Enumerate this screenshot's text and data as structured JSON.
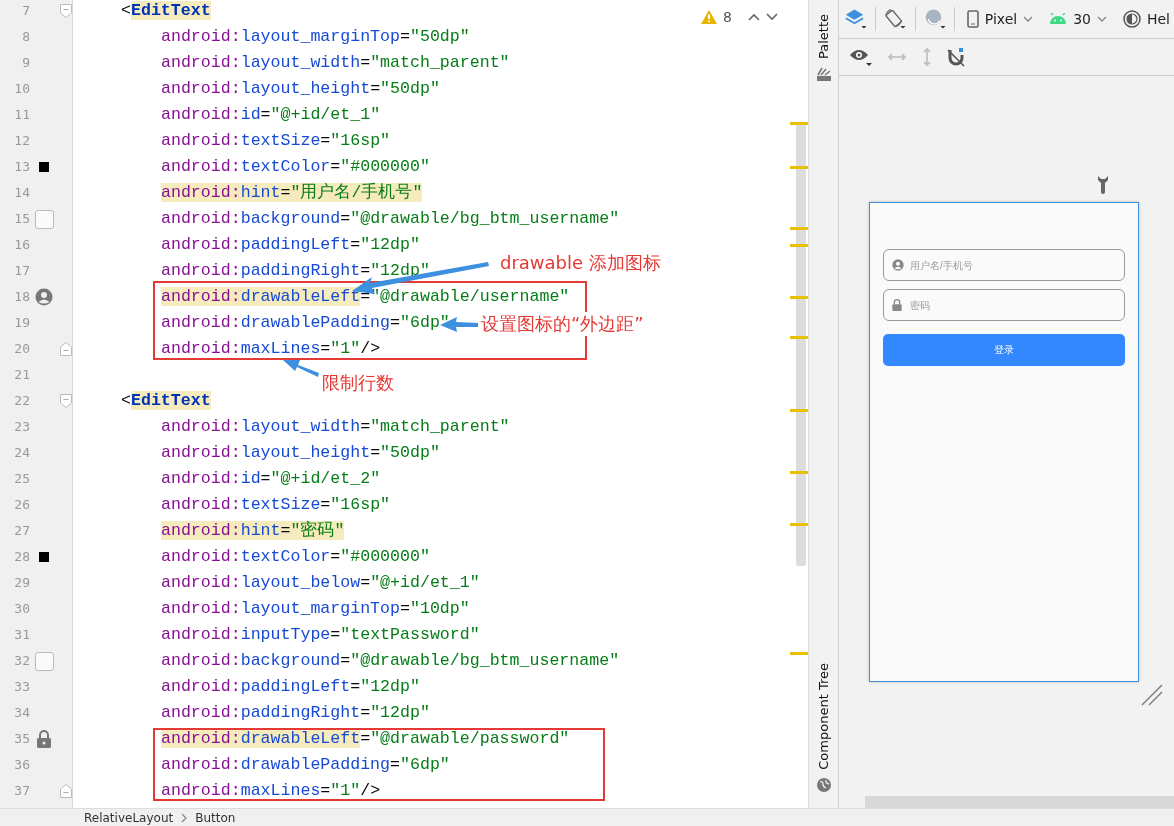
{
  "editor": {
    "warning_count": "8",
    "lines": [
      {
        "number": "7",
        "kind": "tag",
        "fold_marker": {
          "kind": "start"
        },
        "tokens": [
          {
            "text": "<",
            "kind": "punct",
            "highlighted": false
          },
          {
            "text": "EditText",
            "kind": "tag",
            "highlighted": true
          }
        ]
      },
      {
        "number": "8",
        "kind": "attribute",
        "tokens": [
          {
            "text": "android:",
            "kind": "ns",
            "highlighted": false
          },
          {
            "text": "layout_marginTop",
            "kind": "attr",
            "highlighted": false
          },
          {
            "text": "=",
            "kind": "punct",
            "highlighted": false
          },
          {
            "text": "\"50dp\"",
            "kind": "string",
            "highlighted": false
          }
        ]
      },
      {
        "number": "9",
        "kind": "attribute",
        "tokens": [
          {
            "text": "android:",
            "kind": "ns",
            "highlighted": false
          },
          {
            "text": "layout_width",
            "kind": "attr",
            "highlighted": false
          },
          {
            "text": "=",
            "kind": "punct",
            "highlighted": false
          },
          {
            "text": "\"match_parent\"",
            "kind": "string",
            "highlighted": false
          }
        ]
      },
      {
        "number": "10",
        "kind": "attribute",
        "tokens": [
          {
            "text": "android:",
            "kind": "ns",
            "highlighted": false
          },
          {
            "text": "layout_height",
            "kind": "attr",
            "highlighted": false
          },
          {
            "text": "=",
            "kind": "punct",
            "highlighted": false
          },
          {
            "text": "\"50dp\"",
            "kind": "string",
            "highlighted": false
          }
        ]
      },
      {
        "number": "11",
        "kind": "attribute",
        "tokens": [
          {
            "text": "android:",
            "kind": "ns",
            "highlighted": false
          },
          {
            "text": "id",
            "kind": "attr",
            "highlighted": false
          },
          {
            "text": "=",
            "kind": "punct",
            "highlighted": false
          },
          {
            "text": "\"@+id/et_1\"",
            "kind": "string",
            "highlighted": false
          }
        ]
      },
      {
        "number": "12",
        "kind": "attribute",
        "tokens": [
          {
            "text": "android:",
            "kind": "ns",
            "highlighted": false
          },
          {
            "text": "textSize",
            "kind": "attr",
            "highlighted": false
          },
          {
            "text": "=",
            "kind": "punct",
            "highlighted": false
          },
          {
            "text": "\"16sp\"",
            "kind": "string",
            "highlighted": false
          }
        ]
      },
      {
        "number": "13",
        "kind": "attribute",
        "gutter_icon": {
          "kind": "swatch"
        },
        "tokens": [
          {
            "text": "android:",
            "kind": "ns",
            "highlighted": false
          },
          {
            "text": "textColor",
            "kind": "attr",
            "highlighted": false
          },
          {
            "text": "=",
            "kind": "punct",
            "highlighted": false
          },
          {
            "text": "\"#000000\"",
            "kind": "string",
            "highlighted": false
          }
        ]
      },
      {
        "number": "14",
        "kind": "attribute",
        "tokens": [
          {
            "text": "android:",
            "kind": "ns",
            "highlighted": true
          },
          {
            "text": "hint",
            "kind": "attr",
            "highlighted": true
          },
          {
            "text": "=",
            "kind": "punct",
            "highlighted": true
          },
          {
            "text": "\"用户名/手机号\"",
            "kind": "string",
            "highlighted": true
          }
        ]
      },
      {
        "number": "15",
        "kind": "attribute",
        "gutter_icon": {
          "kind": "drawable"
        },
        "tokens": [
          {
            "text": "android:",
            "kind": "ns",
            "highlighted": false
          },
          {
            "text": "background",
            "kind": "attr",
            "highlighted": false
          },
          {
            "text": "=",
            "kind": "punct",
            "highlighted": false
          },
          {
            "text": "\"@drawable/bg_btm_username\"",
            "kind": "string",
            "highlighted": false
          }
        ]
      },
      {
        "number": "16",
        "kind": "attribute",
        "tokens": [
          {
            "text": "android:",
            "kind": "ns",
            "highlighted": false
          },
          {
            "text": "paddingLeft",
            "kind": "attr",
            "highlighted": false
          },
          {
            "text": "=",
            "kind": "punct",
            "highlighted": false
          },
          {
            "text": "\"12dp\"",
            "kind": "string",
            "highlighted": false
          }
        ]
      },
      {
        "number": "17",
        "kind": "attribute",
        "tokens": [
          {
            "text": "android:",
            "kind": "ns",
            "highlighted": false
          },
          {
            "text": "paddingRight",
            "kind": "attr",
            "highlighted": false
          },
          {
            "text": "=",
            "kind": "punct",
            "highlighted": false
          },
          {
            "text": "\"12dp\"",
            "kind": "string",
            "highlighted": false
          }
        ]
      },
      {
        "number": "18",
        "kind": "attribute",
        "gutter_icon": {
          "kind": "person"
        },
        "tokens": [
          {
            "text": "android:",
            "kind": "ns",
            "highlighted": true
          },
          {
            "text": "drawableLeft",
            "kind": "attr",
            "highlighted": true
          },
          {
            "text": "=",
            "kind": "punct",
            "highlighted": false
          },
          {
            "text": "\"@drawable/username\"",
            "kind": "string",
            "highlighted": false
          }
        ]
      },
      {
        "number": "19",
        "kind": "attribute",
        "tokens": [
          {
            "text": "android:",
            "kind": "ns",
            "highlighted": false
          },
          {
            "text": "drawablePadding",
            "kind": "attr",
            "highlighted": false
          },
          {
            "text": "=",
            "kind": "punct",
            "highlighted": false
          },
          {
            "text": "\"6dp\"",
            "kind": "string",
            "highlighted": false
          }
        ]
      },
      {
        "number": "20",
        "kind": "attribute",
        "fold_marker": {
          "kind": "end"
        },
        "tokens": [
          {
            "text": "android:",
            "kind": "ns",
            "highlighted": false
          },
          {
            "text": "maxLines",
            "kind": "attr",
            "highlighted": false
          },
          {
            "text": "=",
            "kind": "punct",
            "highlighted": false
          },
          {
            "text": "\"1\"",
            "kind": "string",
            "highlighted": false
          },
          {
            "text": "/>",
            "kind": "punct",
            "highlighted": false
          }
        ]
      },
      {
        "number": "21",
        "kind": "blank"
      },
      {
        "number": "22",
        "kind": "tag",
        "fold_marker": {
          "kind": "start"
        },
        "tokens": [
          {
            "text": "<",
            "kind": "punct",
            "highlighted": false
          },
          {
            "text": "EditText",
            "kind": "tag",
            "highlighted": true
          }
        ]
      },
      {
        "number": "23",
        "kind": "attribute",
        "tokens": [
          {
            "text": "android:",
            "kind": "ns",
            "highlighted": false
          },
          {
            "text": "layout_width",
            "kind": "attr",
            "highlighted": false
          },
          {
            "text": "=",
            "kind": "punct",
            "highlighted": false
          },
          {
            "text": "\"match_parent\"",
            "kind": "string",
            "highlighted": false
          }
        ]
      },
      {
        "number": "24",
        "kind": "attribute",
        "tokens": [
          {
            "text": "android:",
            "kind": "ns",
            "highlighted": false
          },
          {
            "text": "layout_height",
            "kind": "attr",
            "highlighted": false
          },
          {
            "text": "=",
            "kind": "punct",
            "highlighted": false
          },
          {
            "text": "\"50dp\"",
            "kind": "string",
            "highlighted": false
          }
        ]
      },
      {
        "number": "25",
        "kind": "attribute",
        "tokens": [
          {
            "text": "android:",
            "kind": "ns",
            "highlighted": false
          },
          {
            "text": "id",
            "kind": "attr",
            "highlighted": false
          },
          {
            "text": "=",
            "kind": "punct",
            "highlighted": false
          },
          {
            "text": "\"@+id/et_2\"",
            "kind": "string",
            "highlighted": false
          }
        ]
      },
      {
        "number": "26",
        "kind": "attribute",
        "tokens": [
          {
            "text": "android:",
            "kind": "ns",
            "highlighted": false
          },
          {
            "text": "textSize",
            "kind": "attr",
            "highlighted": false
          },
          {
            "text": "=",
            "kind": "punct",
            "highlighted": false
          },
          {
            "text": "\"16sp\"",
            "kind": "string",
            "highlighted": false
          }
        ]
      },
      {
        "number": "27",
        "kind": "attribute",
        "tokens": [
          {
            "text": "android:",
            "kind": "ns",
            "highlighted": true
          },
          {
            "text": "hint",
            "kind": "attr",
            "highlighted": true
          },
          {
            "text": "=",
            "kind": "punct",
            "highlighted": true
          },
          {
            "text": "\"密码\"",
            "kind": "string",
            "highlighted": true
          }
        ]
      },
      {
        "number": "28",
        "kind": "attribute",
        "gutter_icon": {
          "kind": "swatch"
        },
        "tokens": [
          {
            "text": "android:",
            "kind": "ns",
            "highlighted": false
          },
          {
            "text": "textColor",
            "kind": "attr",
            "highlighted": false
          },
          {
            "text": "=",
            "kind": "punct",
            "highlighted": false
          },
          {
            "text": "\"#000000\"",
            "kind": "string",
            "highlighted": false
          }
        ]
      },
      {
        "number": "29",
        "kind": "attribute",
        "tokens": [
          {
            "text": "android:",
            "kind": "ns",
            "highlighted": false
          },
          {
            "text": "layout_below",
            "kind": "attr",
            "highlighted": false
          },
          {
            "text": "=",
            "kind": "punct",
            "highlighted": false
          },
          {
            "text": "\"@+id/et_1\"",
            "kind": "string",
            "highlighted": false
          }
        ]
      },
      {
        "number": "30",
        "kind": "attribute",
        "tokens": [
          {
            "text": "android:",
            "kind": "ns",
            "highlighted": false
          },
          {
            "text": "layout_marginTop",
            "kind": "attr",
            "highlighted": false
          },
          {
            "text": "=",
            "kind": "punct",
            "highlighted": false
          },
          {
            "text": "\"10dp\"",
            "kind": "string",
            "highlighted": false
          }
        ]
      },
      {
        "number": "31",
        "kind": "attribute",
        "tokens": [
          {
            "text": "android:",
            "kind": "ns",
            "highlighted": false
          },
          {
            "text": "inputType",
            "kind": "attr",
            "highlighted": false
          },
          {
            "text": "=",
            "kind": "punct",
            "highlighted": false
          },
          {
            "text": "\"textPassword\"",
            "kind": "string",
            "highlighted": false
          }
        ]
      },
      {
        "number": "32",
        "kind": "attribute",
        "gutter_icon": {
          "kind": "drawable"
        },
        "tokens": [
          {
            "text": "android:",
            "kind": "ns",
            "highlighted": false
          },
          {
            "text": "background",
            "kind": "attr",
            "highlighted": false
          },
          {
            "text": "=",
            "kind": "punct",
            "highlighted": false
          },
          {
            "text": "\"@drawable/bg_btm_username\"",
            "kind": "string",
            "highlighted": false
          }
        ]
      },
      {
        "number": "33",
        "kind": "attribute",
        "tokens": [
          {
            "text": "android:",
            "kind": "ns",
            "highlighted": false
          },
          {
            "text": "paddingLeft",
            "kind": "attr",
            "highlighted": false
          },
          {
            "text": "=",
            "kind": "punct",
            "highlighted": false
          },
          {
            "text": "\"12dp\"",
            "kind": "string",
            "highlighted": false
          }
        ]
      },
      {
        "number": "34",
        "kind": "attribute",
        "tokens": [
          {
            "text": "android:",
            "kind": "ns",
            "highlighted": false
          },
          {
            "text": "paddingRight",
            "kind": "attr",
            "highlighted": false
          },
          {
            "text": "=",
            "kind": "punct",
            "highlighted": false
          },
          {
            "text": "\"12dp\"",
            "kind": "string",
            "highlighted": false
          }
        ]
      },
      {
        "number": "35",
        "kind": "attribute",
        "gutter_icon": {
          "kind": "lock"
        },
        "tokens": [
          {
            "text": "android:",
            "kind": "ns",
            "highlighted": true
          },
          {
            "text": "drawableLeft",
            "kind": "attr",
            "highlighted": true
          },
          {
            "text": "=",
            "kind": "punct",
            "highlighted": false
          },
          {
            "text": "\"@drawable/password\"",
            "kind": "string",
            "highlighted": false
          }
        ]
      },
      {
        "number": "36",
        "kind": "attribute",
        "tokens": [
          {
            "text": "android:",
            "kind": "ns",
            "highlighted": false
          },
          {
            "text": "drawablePadding",
            "kind": "attr",
            "highlighted": false
          },
          {
            "text": "=",
            "kind": "punct",
            "highlighted": false
          },
          {
            "text": "\"6dp\"",
            "kind": "string",
            "highlighted": false
          }
        ]
      },
      {
        "number": "37",
        "kind": "attribute",
        "fold_marker": {
          "kind": "end"
        },
        "tokens": [
          {
            "text": "android:",
            "kind": "ns",
            "highlighted": false
          },
          {
            "text": "maxLines",
            "kind": "attr",
            "highlighted": false
          },
          {
            "text": "=",
            "kind": "punct",
            "highlighted": false
          },
          {
            "text": "\"1\"",
            "kind": "string",
            "highlighted": false
          },
          {
            "text": "/>",
            "kind": "punct",
            "highlighted": false
          }
        ]
      }
    ],
    "annotations": [
      {
        "text": "drawable 添加图标"
      },
      {
        "text": "设置图标的“外边距”"
      },
      {
        "text": "限制行数"
      }
    ]
  },
  "side_tabs": [
    {
      "label": "Palette"
    },
    {
      "label": "Component Tree"
    }
  ],
  "design": {
    "device": "Pixel",
    "api": "30",
    "theme": "Hel",
    "preview": {
      "fields": [
        {
          "kind": "user",
          "placeholder": "用户名/手机号"
        },
        {
          "kind": "lock",
          "placeholder": "密码"
        }
      ],
      "button": "登录"
    }
  },
  "breadcrumb": [
    "RelativeLayout",
    "Button"
  ]
}
